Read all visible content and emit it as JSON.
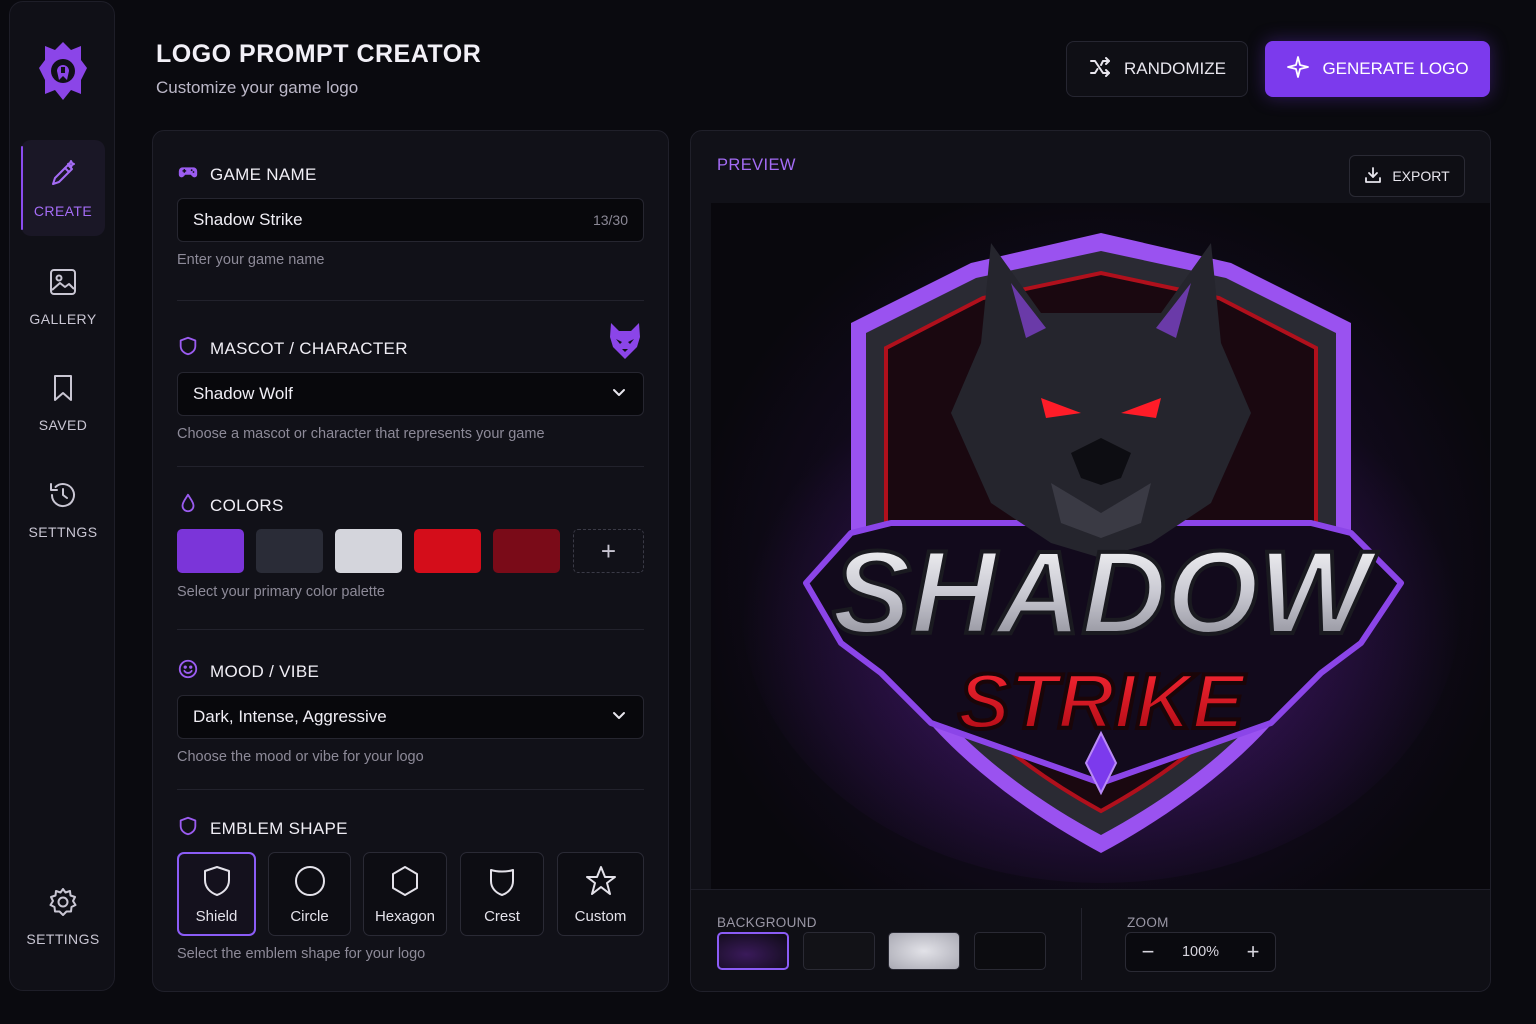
{
  "header": {
    "title": "LOGO PROMPT CREATOR",
    "subtitle": "Customize your game logo",
    "randomize_label": "RANDOMIZE",
    "generate_label": "GENERATE LOGO"
  },
  "sidebar": {
    "items": [
      {
        "label": "CREATE",
        "icon": "pen-sparkle-icon",
        "active": true
      },
      {
        "label": "GALLERY",
        "icon": "image-icon"
      },
      {
        "label": "SAVED",
        "icon": "bookmark-icon"
      },
      {
        "label": "SETTNGS",
        "icon": "history-icon"
      },
      {
        "label": "SETTINGS",
        "icon": "gear-icon"
      }
    ]
  },
  "form": {
    "game_name": {
      "label": "GAME NAME",
      "value": "Shadow Strike",
      "counter": "13/30",
      "hint": "Enter your game name"
    },
    "mascot": {
      "label": "MASCOT / CHARACTER",
      "value": "Shadow Wolf",
      "hint": "Choose a mascot or character that represents your game"
    },
    "colors": {
      "label": "COLORS",
      "swatches": [
        "#7b35d9",
        "#2a2c37",
        "#d4d5dc",
        "#d40d1a",
        "#7a0b18"
      ],
      "add_symbol": "+",
      "hint": "Select your primary color palette"
    },
    "mood": {
      "label": "MOOD / VIBE",
      "value": "Dark, Intense, Aggressive",
      "hint": "Choose the mood or vibe for your logo"
    },
    "emblem": {
      "label": "EMBLEM SHAPE",
      "options": [
        "Shield",
        "Circle",
        "Hexagon",
        "Crest",
        "Custom"
      ],
      "selected": "Shield",
      "hint": "Select the emblem shape for your logo"
    }
  },
  "preview": {
    "label": "PREVIEW",
    "export_label": "EXPORT",
    "logo_text_top": "SHADOW",
    "logo_text_bottom": "STRIKE",
    "background_label": "BACKGROUND",
    "zoom_label": "ZOOM",
    "zoom_value": "100%",
    "zoom_minus": "−",
    "zoom_plus": "+"
  },
  "colors": {
    "accent": "#7c3aed",
    "accent_text": "#a46cf5",
    "logo_red": "#d41220"
  }
}
